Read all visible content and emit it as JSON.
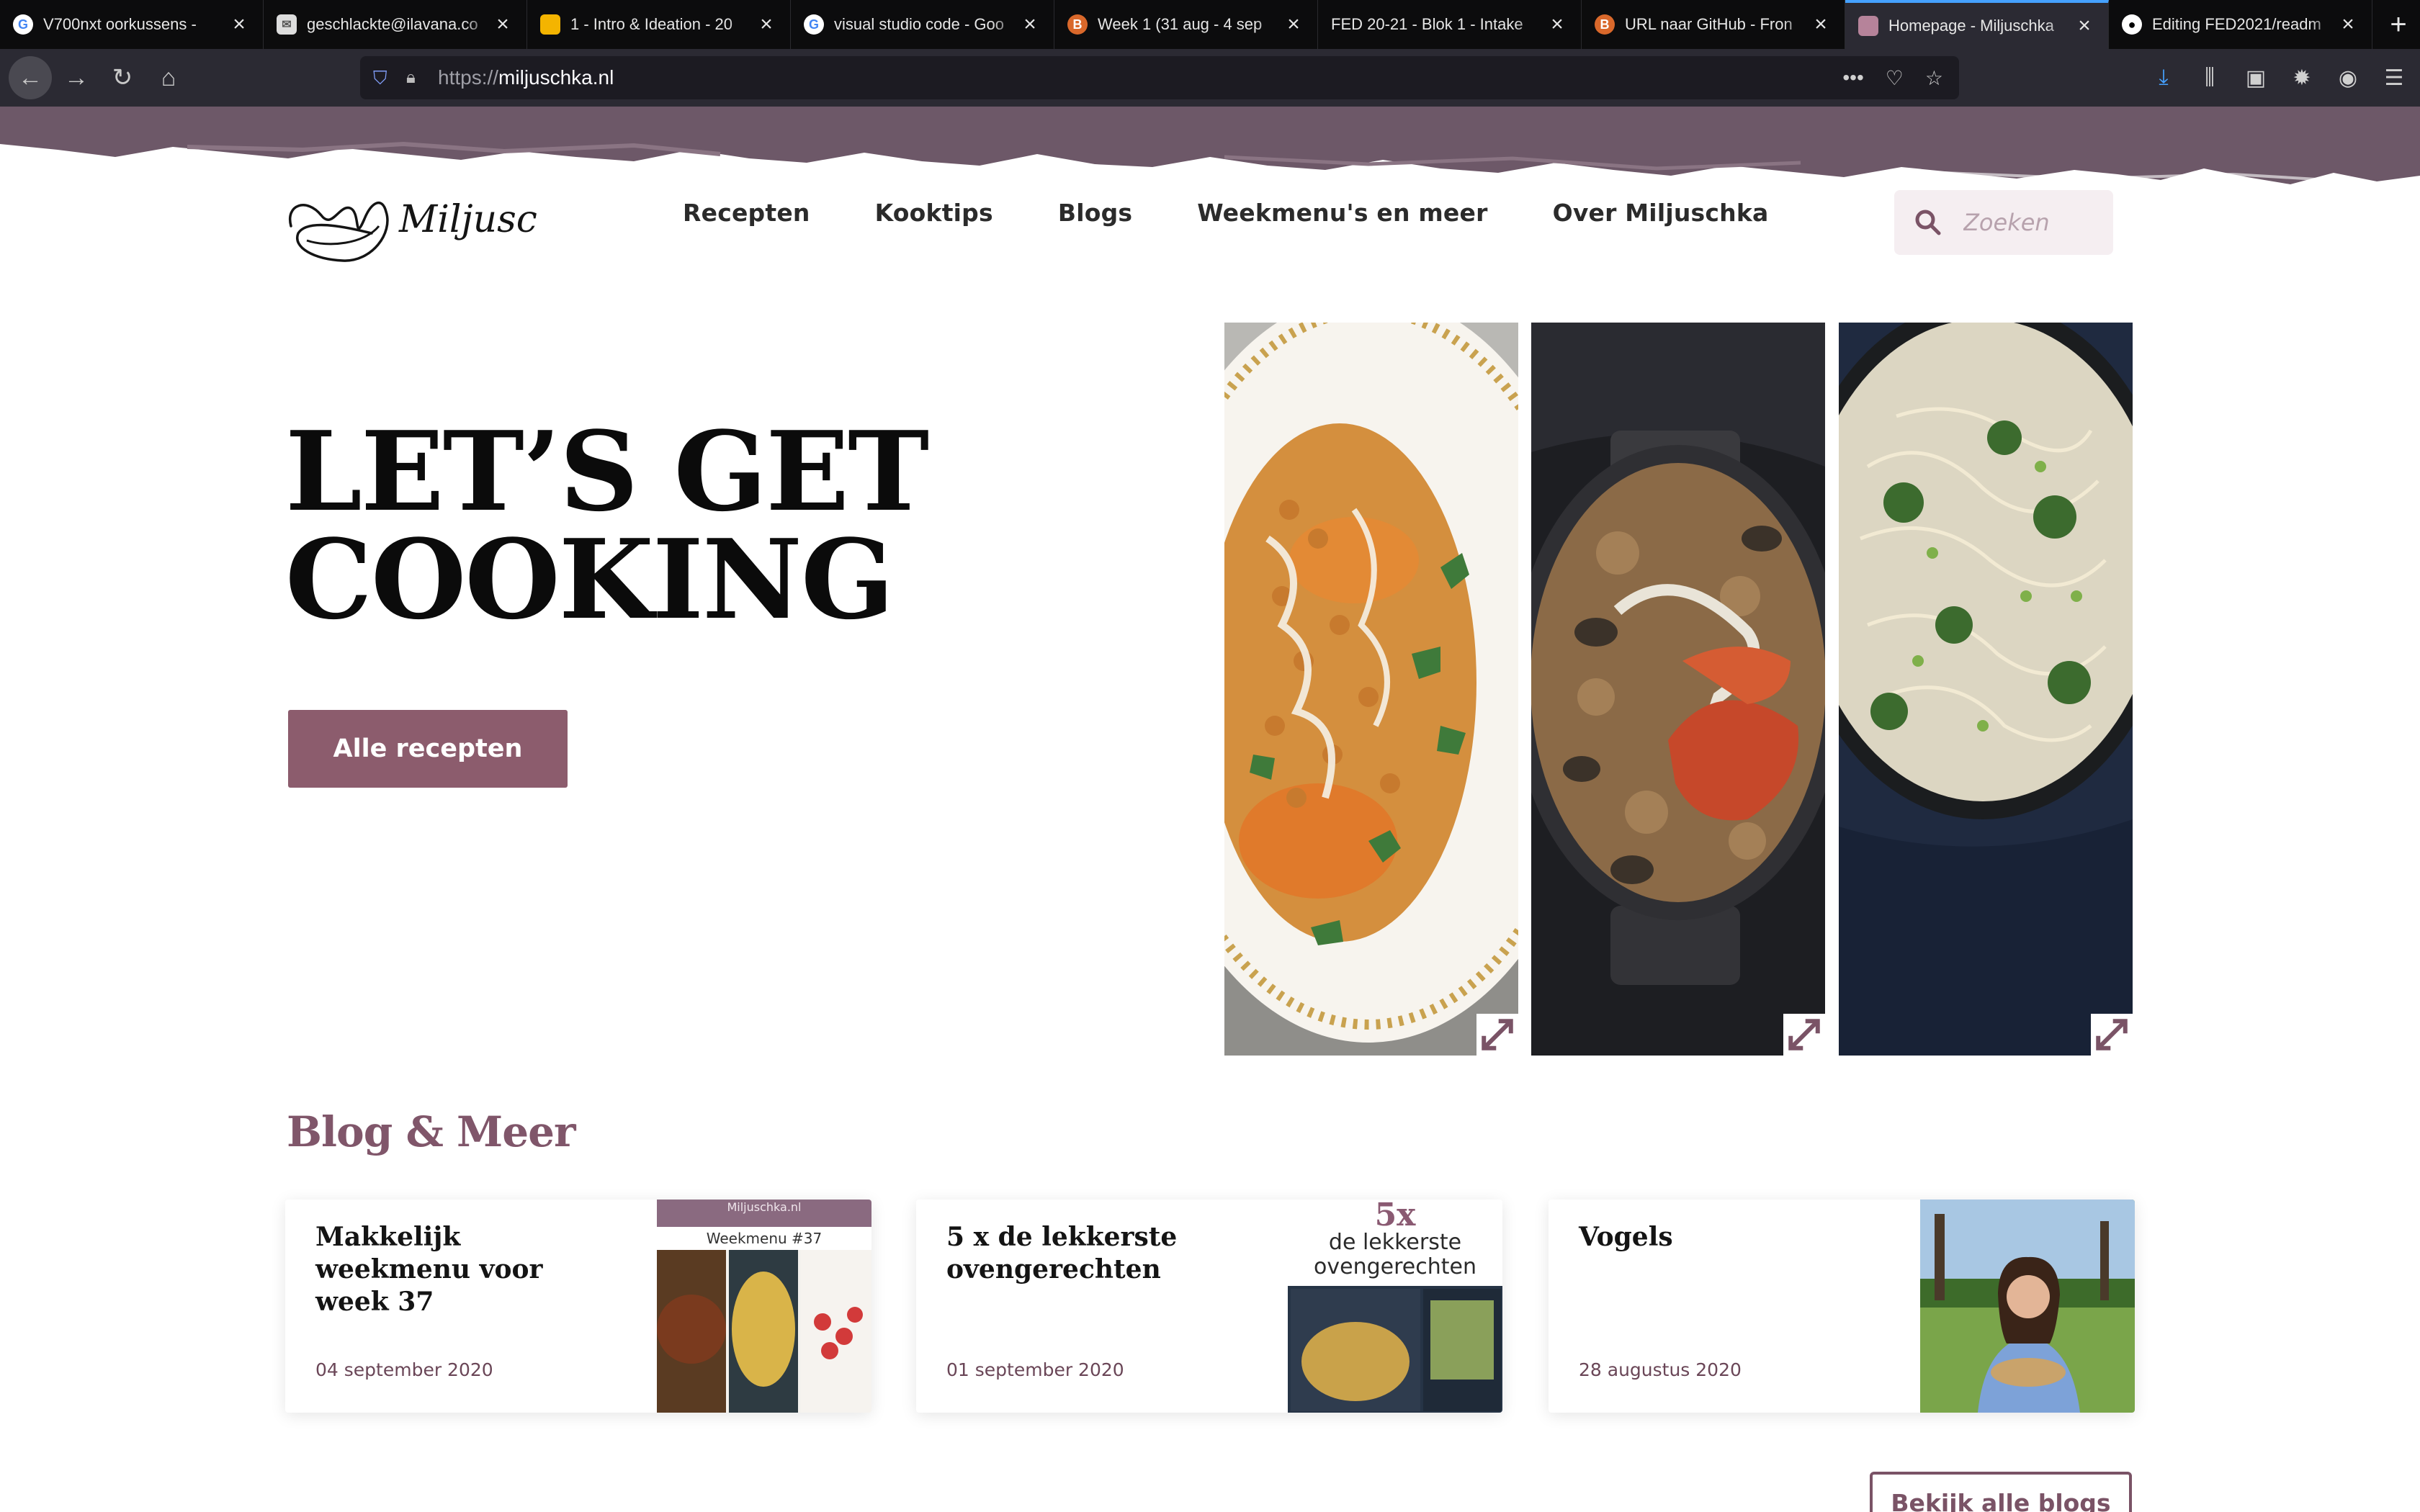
{
  "browser": {
    "tabs": [
      {
        "title": "V700nxt oorkussens - ",
        "favicon": "google-icon",
        "active": false
      },
      {
        "title": "geschlackte@ilavana.co",
        "favicon": "mail-icon",
        "active": false
      },
      {
        "title": "1 - Intro & Ideation - 20",
        "favicon": "slides-icon",
        "active": false
      },
      {
        "title": "visual studio code - Goo",
        "favicon": "google-icon",
        "active": false
      },
      {
        "title": "Week 1 (31 aug - 4 sep",
        "favicon": "b-icon",
        "active": false
      },
      {
        "title": "FED 20-21 - Blok 1 - Intake",
        "favicon": "",
        "active": false
      },
      {
        "title": "URL naar GitHub - Fron",
        "favicon": "b-icon",
        "active": false
      },
      {
        "title": "Homepage - Miljuschka",
        "favicon": "miljuschka-icon",
        "active": true
      },
      {
        "title": "Editing FED2021/readm",
        "favicon": "github-icon",
        "active": false
      }
    ],
    "url_scheme": "https://",
    "url_host": "miljuschka.nl"
  },
  "site": {
    "logo_text": "Miljuschka",
    "nav": [
      "Recepten",
      "Kooktips",
      "Blogs",
      "Weekmenu's en meer",
      "Over Miljuschka"
    ],
    "search_placeholder": "Zoeken"
  },
  "hero": {
    "line1": "LET’S GET",
    "line2": "COOKING",
    "cta": "Alle recepten"
  },
  "gallery": [
    {
      "name": "chickpea-sweet-potato-dish",
      "plate": "#f7f4ee",
      "accent": "#c47a2f"
    },
    {
      "name": "seafood-paella-pan",
      "plate": "#2a2a2c",
      "accent": "#b64a2c"
    },
    {
      "name": "green-pasta-bowl",
      "plate": "#232629",
      "accent": "#e9e1cf"
    }
  ],
  "blog": {
    "section_title": "Blog & Meer",
    "cards": [
      {
        "title": "Makkelijk weekmenu voor week 37",
        "date": "04 september 2020",
        "thumb_caption": "Weekmenu #37",
        "thumb_brand": "Miljuschka.nl"
      },
      {
        "title": "5 x de lekkerste ovengerechten",
        "date": "01 september 2020",
        "thumb_big": "5x",
        "thumb_l1": "de lekkerste",
        "thumb_l2": "ovengerechten"
      },
      {
        "title": "Vogels",
        "date": "28 augustus 2020"
      }
    ],
    "more_button": "Bekijk alle blogs"
  },
  "colors": {
    "brand": "#8c5c6d",
    "brush": "#6d5868",
    "heading": "#80566a"
  }
}
